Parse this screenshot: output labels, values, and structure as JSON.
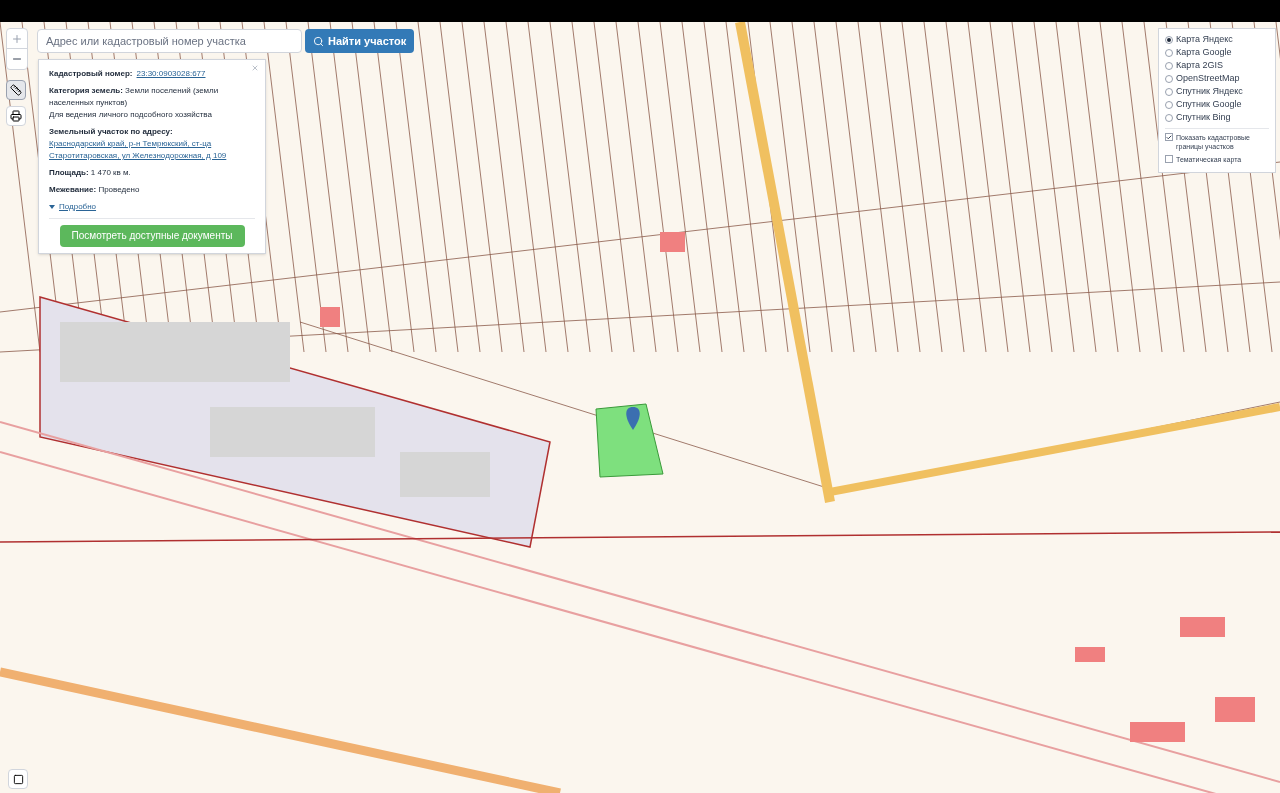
{
  "search": {
    "placeholder": "Адрес или кадастровый номер участка",
    "button": "Найти участок"
  },
  "info": {
    "fields": [
      {
        "label": "Кадастровый номер:",
        "value": "23:30:0903028:677",
        "kind": "link"
      },
      {
        "label": "Категория земель:",
        "value": "Земли поселений (земли населенных пунктов)",
        "kind": "text",
        "note": "Для ведения личного подсобного хозяйства"
      },
      {
        "label": "Земельный участок по адресу:",
        "value": "Краснодарский край, р-н Темрюкский, ст-ца Старотитаровская, ул Железнодорожная, д 109",
        "kind": "link"
      },
      {
        "label": "Площадь:",
        "value": "1 470 кв м.",
        "kind": "text"
      },
      {
        "label": "Межевание:",
        "value": "Проведено",
        "kind": "text"
      }
    ],
    "details": {
      "label": "Подробно",
      "expanded": false
    },
    "button": "Посмотреть доступные документы"
  },
  "layers": {
    "base": [
      {
        "label": "Карта Яндекс",
        "selected": true
      },
      {
        "label": "Карта Google",
        "selected": false
      },
      {
        "label": "Карта 2GIS",
        "selected": false
      },
      {
        "label": "OpenStreetMap",
        "selected": false
      },
      {
        "label": "Спутник Яндекс",
        "selected": false
      },
      {
        "label": "Спутник Google",
        "selected": false
      },
      {
        "label": "Спутник Bing",
        "selected": false
      }
    ],
    "overlays": [
      {
        "label": "Показать кадастровые границы участков",
        "checked": true
      },
      {
        "label": "Тематическая карта",
        "checked": false
      }
    ]
  }
}
